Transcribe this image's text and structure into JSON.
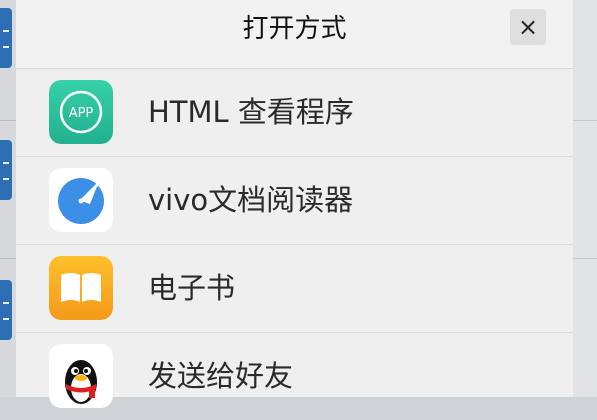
{
  "dialog": {
    "title": "打开方式",
    "close_label": "×"
  },
  "apps": [
    {
      "label": "HTML 查看程序",
      "icon": "app-badge-icon",
      "icon_text": "APP",
      "color": "#2ec4a0"
    },
    {
      "label": "vivo文档阅读器",
      "icon": "compass-dial-icon",
      "color": "#3c8fe6"
    },
    {
      "label": "电子书",
      "icon": "open-book-icon",
      "color": "#f5a623"
    },
    {
      "label": "发送给好友",
      "icon": "qq-penguin-icon",
      "color": "#000000"
    }
  ]
}
